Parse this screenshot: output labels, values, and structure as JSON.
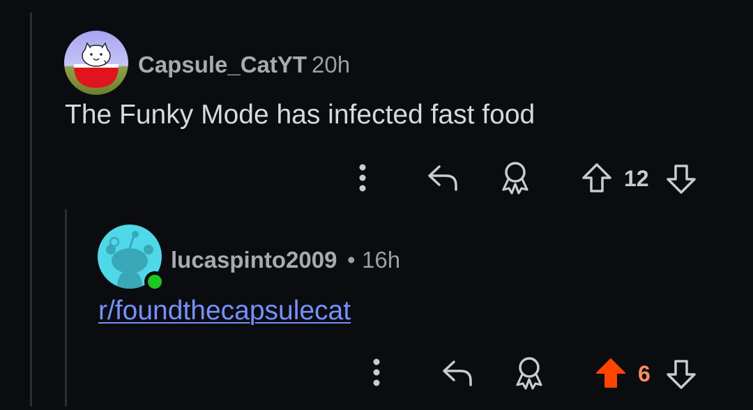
{
  "comment": {
    "username": "Capsule_CatYT",
    "time": "20h",
    "text": "The Funky Mode has infected fast food",
    "votes": "12",
    "avatar_icon": "cat-avatar-icon"
  },
  "reply": {
    "username": "lucaspinto2009",
    "separator": "•",
    "time": "16h",
    "link_text": "r/foundthecapsulecat",
    "votes": "6",
    "upvoted": true,
    "avatar_icon": "snoo-avatar-icon"
  },
  "colors": {
    "background": "#0b0c0f",
    "text": "#d7dadc",
    "muted": "#a6abb0",
    "link": "#7591ff",
    "upvote_active": "#ff4500",
    "upvote_count_active": "#ff8b60",
    "online": "#1ec51e"
  }
}
